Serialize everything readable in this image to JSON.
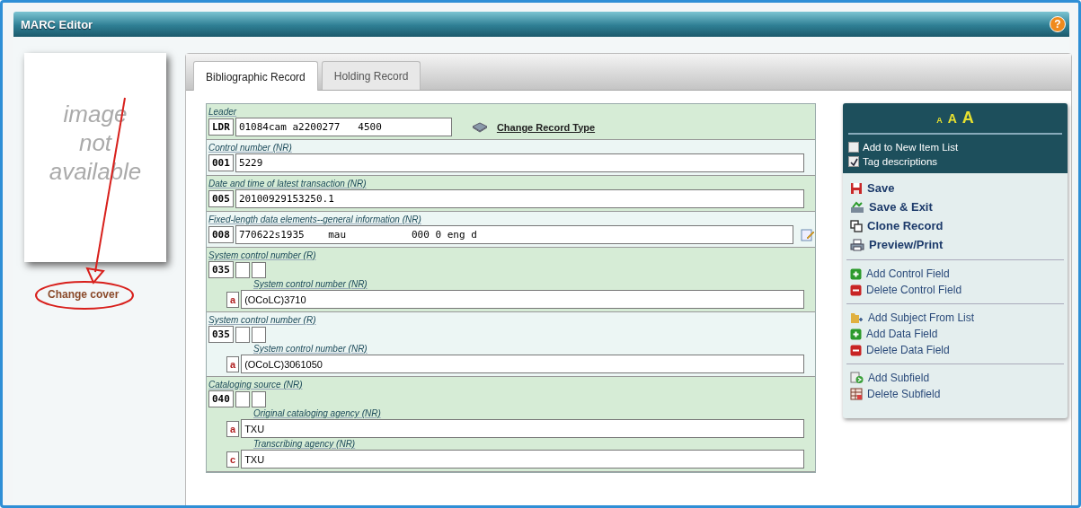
{
  "window": {
    "title": "MARC Editor",
    "help": "?"
  },
  "cover": {
    "placeholder_lines": [
      "image",
      "not",
      "available"
    ],
    "link": "Change cover"
  },
  "tabs": [
    {
      "label": "Bibliographic Record",
      "selected": true
    },
    {
      "label": "Holding Record",
      "selected": false
    }
  ],
  "fields": [
    {
      "kind": "control",
      "label": "Leader",
      "tag": "LDR",
      "value": "01084cam a2200277   4500",
      "link": "Change Record Type"
    },
    {
      "kind": "control",
      "label": "Control number (NR)",
      "tag": "001",
      "value": "5229"
    },
    {
      "kind": "control",
      "label": "Date and time of latest transaction (NR)",
      "tag": "005",
      "value": "20100929153250.1"
    },
    {
      "kind": "control",
      "label": "Fixed-length data elements--general information (NR)",
      "tag": "008",
      "value": "770622s1935    mau           000 0 eng d",
      "editable": true
    },
    {
      "kind": "data",
      "label": "System control number (R)",
      "tag": "035",
      "subfields": [
        {
          "label": "System control number (NR)",
          "code": "a",
          "value": "(OCoLC)3710"
        }
      ]
    },
    {
      "kind": "data",
      "label": "System control number (R)",
      "tag": "035",
      "subfields": [
        {
          "label": "System control number (NR)",
          "code": "a",
          "value": "(OCoLC)3061050"
        }
      ]
    },
    {
      "kind": "data",
      "label": "Cataloging source (NR)",
      "tag": "040",
      "subfields": [
        {
          "label": "Original cataloging agency (NR)",
          "code": "a",
          "value": "TXU"
        },
        {
          "label": "Transcribing agency (NR)",
          "code": "c",
          "value": "TXU"
        }
      ]
    }
  ],
  "sidebar": {
    "font_sizes": [
      "A",
      "A",
      "A"
    ],
    "options": [
      {
        "label": "Add to New Item List",
        "checked": false
      },
      {
        "label": "Tag descriptions",
        "checked": true
      }
    ],
    "groups": [
      [
        {
          "kind": "save",
          "label": "Save"
        },
        {
          "kind": "save-exit",
          "label": "Save & Exit"
        },
        {
          "kind": "clone",
          "label": "Clone Record"
        },
        {
          "kind": "print",
          "label": "Preview/Print"
        }
      ],
      [
        {
          "kind": "add",
          "label": "Add Control Field"
        },
        {
          "kind": "delete",
          "label": "Delete Control Field"
        }
      ],
      [
        {
          "kind": "subject",
          "label": "Add Subject From List"
        },
        {
          "kind": "add",
          "label": "Add Data Field"
        },
        {
          "kind": "delete",
          "label": "Delete Data Field"
        }
      ],
      [
        {
          "kind": "add-subfield",
          "label": "Add Subfield"
        },
        {
          "kind": "delete-subfield",
          "label": "Delete Subfield"
        }
      ]
    ]
  }
}
